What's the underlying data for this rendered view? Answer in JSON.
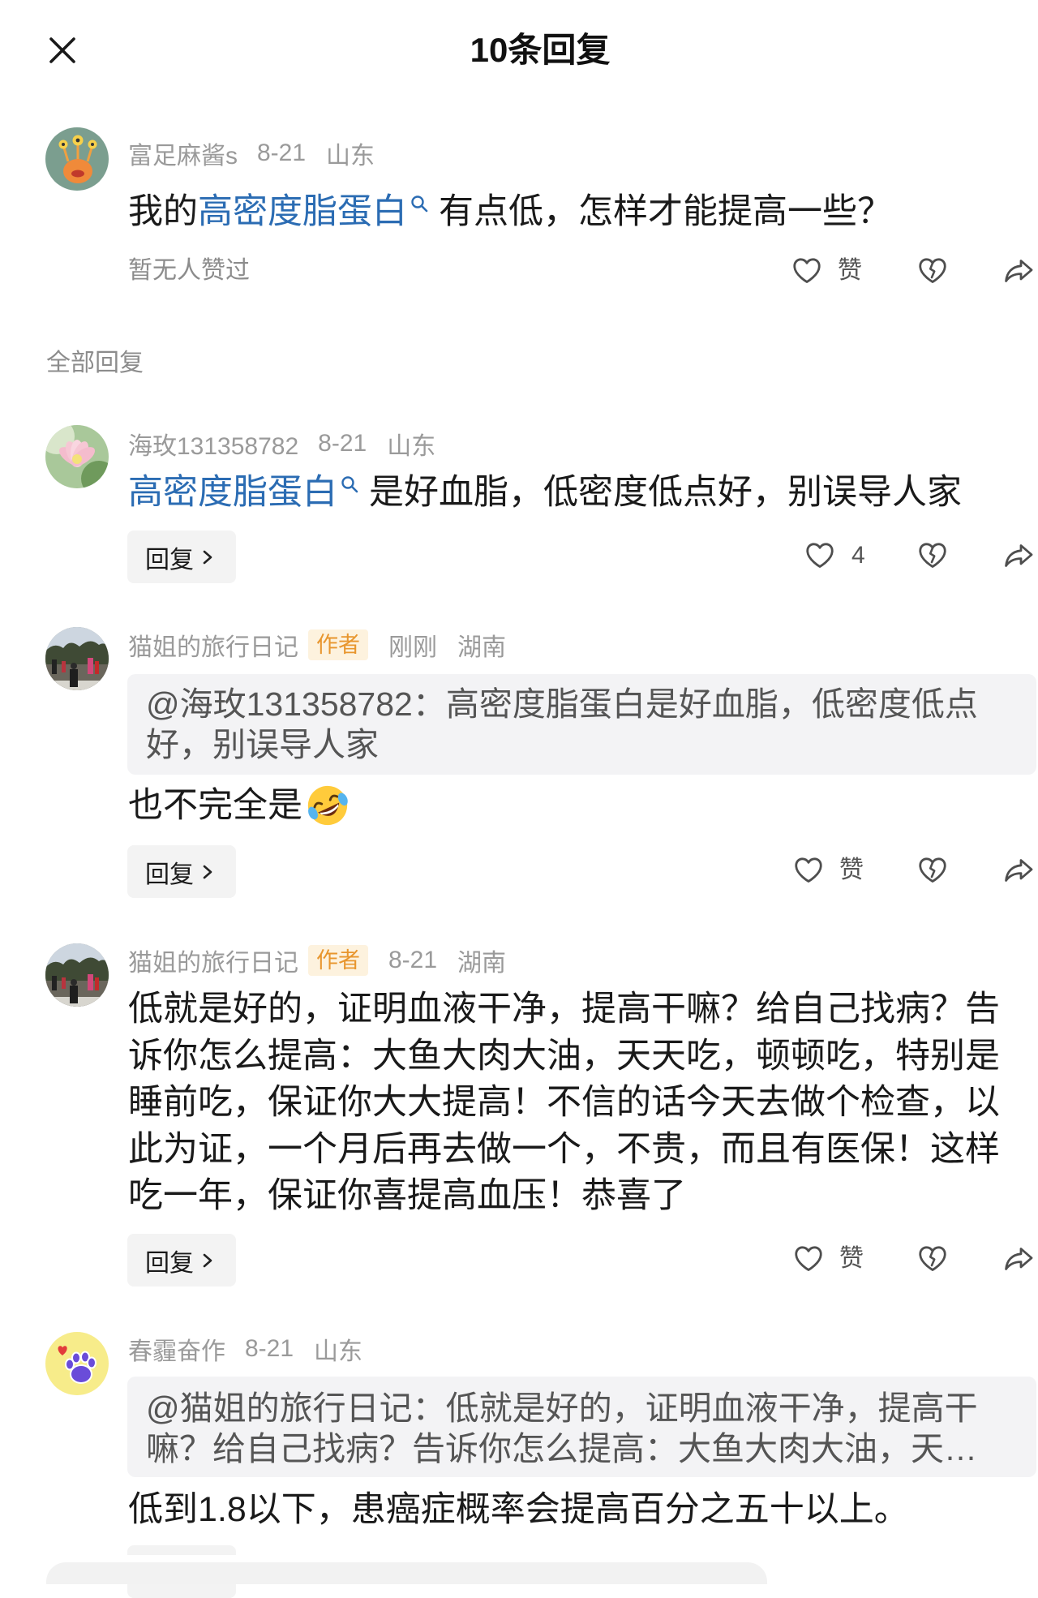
{
  "header": {
    "title": "10条回复",
    "close_icon": "close-icon"
  },
  "colors": {
    "text": "#1a1a1a",
    "meta_gray": "#9a9a9a",
    "link_blue": "#2b6cb3",
    "badge_bg": "#fdf2de",
    "badge_text": "#e8962e",
    "chip_bg": "#f3f3f3",
    "quote_bg": "#f3f3f5"
  },
  "main_comment": {
    "avatar_icon": "orange-monster-avatar",
    "user": "富足麻酱s",
    "date": "8-21",
    "location": "山东",
    "text_before": "我的",
    "link_text": "高密度脂蛋白",
    "link_icon": "search-icon",
    "text_after": "有点低，怎样才能提高一些？",
    "likes_status": "暂无人赞过",
    "actions": {
      "like_icon": "heart-icon",
      "like_label": "赞",
      "dislike_icon": "broken-heart-icon",
      "share_icon": "share-icon"
    }
  },
  "section_label": "全部回复",
  "replies": [
    {
      "avatar_icon": "lotus-flower-avatar",
      "user": "海玫131358782",
      "date": "8-21",
      "location": "山东",
      "link_text": "高密度脂蛋白",
      "text_after": "是好血脂，低密度低点好，别误导人家",
      "reply_button": "回复",
      "like_count": "4"
    },
    {
      "avatar_icon": "park-photo-avatar",
      "user": "猫姐的旅行日记",
      "badge": "作者",
      "date": "刚刚",
      "location": "湖南",
      "quote_lines": [
        "@海玫131358782：高密度脂蛋白是好血脂，低密度低点",
        "好，别误导人家"
      ],
      "text": "也不完全是",
      "emoji_icon": "rolling-laughing-emoji",
      "reply_button": "回复",
      "like_label": "赞"
    },
    {
      "avatar_icon": "park-photo-avatar",
      "user": "猫姐的旅行日记",
      "badge": "作者",
      "date": "8-21",
      "location": "湖南",
      "text_lines": [
        "低就是好的，证明血液干净，提高干嘛？给自己找病？告",
        "诉你怎么提高：大鱼大肉大油，天天吃，顿顿吃，特别是",
        "睡前吃，保证你大大提高！不信的话今天去做个检查，以",
        "此为证，一个月后再去做一个，不贵，而且有医保！这样",
        "吃一年，保证你喜提高血压！恭喜了"
      ],
      "reply_button": "回复",
      "like_label": "赞"
    },
    {
      "avatar_icon": "purple-paw-avatar",
      "user": "春霾奋作",
      "date": "8-21",
      "location": "山东",
      "quote_lines": [
        "@猫姐的旅行日记：低就是好的，证明血液干净，提高干",
        "嘛？给自己找病？告诉你怎么提高：大鱼大肉大油，天…"
      ],
      "text": "低到1.8以下，患癌症概率会提高百分之五十以上。"
    }
  ]
}
